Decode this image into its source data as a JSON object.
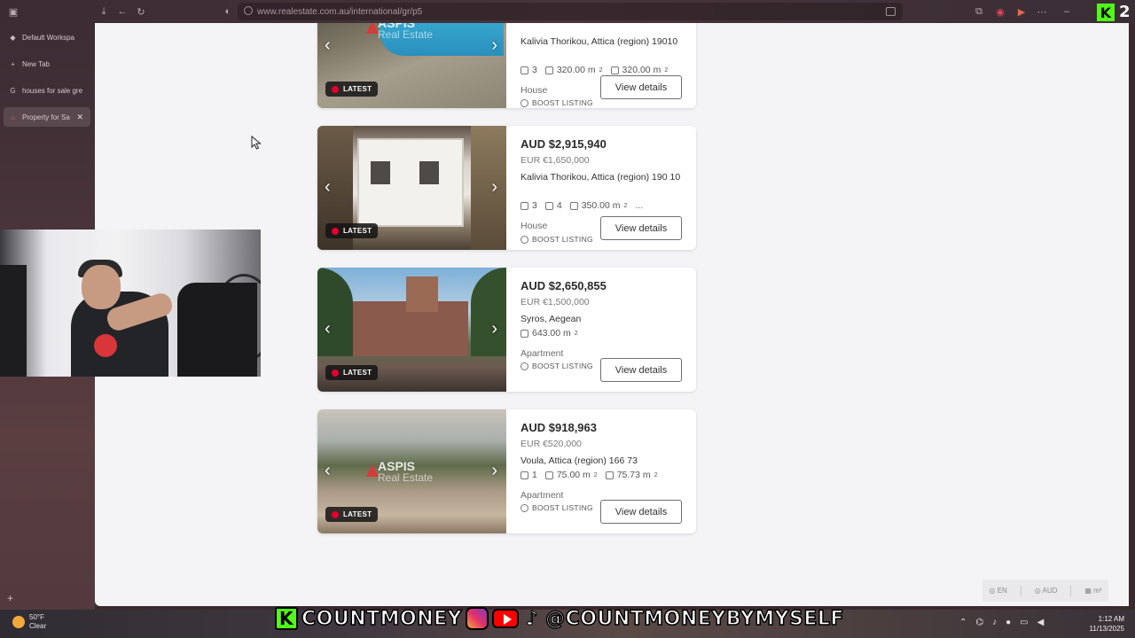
{
  "browser": {
    "url": "www.realestate.com.au/international/gr/p5",
    "workspace": "Default Workspa",
    "new_tab": "New Tab",
    "tabs": [
      {
        "label": "houses for sale gre",
        "active": false
      },
      {
        "label": "Property for Sa",
        "active": true
      }
    ]
  },
  "listings": [
    {
      "price": "",
      "eur": "",
      "address": "Kalivia Thorikou, Attica (region) 19010",
      "features": [
        {
          "icon": "bed-icon",
          "value": "3"
        },
        {
          "icon": "land-area-icon",
          "value": "320.00 m",
          "sup": "2"
        },
        {
          "icon": "floor-area-icon",
          "value": "320.00 m",
          "sup": "2"
        }
      ],
      "type": "House",
      "boost": "BOOST LISTING",
      "button": "View details",
      "badge": "LATEST",
      "watermark": "ASPIS",
      "watermark_sub": "Real Estate"
    },
    {
      "price": "AUD $2,915,940",
      "eur": "EUR €1,650,000",
      "address": "Kalivia Thorikou, Attica (region) 190 10",
      "features": [
        {
          "icon": "bed-icon",
          "value": "3"
        },
        {
          "icon": "bath-icon",
          "value": "4"
        },
        {
          "icon": "land-area-icon",
          "value": "350.00 m",
          "sup": "2"
        },
        {
          "icon": "more-icon",
          "value": "..."
        }
      ],
      "type": "House",
      "boost": "BOOST LISTING",
      "button": "View details",
      "badge": "LATEST"
    },
    {
      "price": "AUD $2,650,855",
      "eur": "EUR €1,500,000",
      "address": "Syros, Aegean",
      "features": [
        {
          "icon": "land-area-icon",
          "value": "643.00 m",
          "sup": "2"
        }
      ],
      "type": "Apartment",
      "boost": "BOOST LISTING",
      "button": "View details",
      "badge": "LATEST"
    },
    {
      "price": "AUD $918,963",
      "eur": "EUR €520,000",
      "address": "Voula, Attica (region) 166 73",
      "features": [
        {
          "icon": "bath-icon",
          "value": "1"
        },
        {
          "icon": "land-area-icon",
          "value": "75.00 m",
          "sup": "2"
        },
        {
          "icon": "floor-area-icon",
          "value": "75.73 m",
          "sup": "2"
        }
      ],
      "type": "Apartment",
      "boost": "BOOST LISTING",
      "button": "View details",
      "badge": "LATEST",
      "watermark": "ASPIS",
      "watermark_sub": "Real Estate"
    }
  ],
  "settings_bar": {
    "lang": "EN",
    "currency": "AUD",
    "unit": "m²"
  },
  "overlay": {
    "k_letter": "K",
    "left_text": "COUNTMONEY",
    "right_text": "@COUNTMONEYBYMYSELF",
    "k_top": "K",
    "k_num": "2"
  },
  "taskbar": {
    "temp": "50°F",
    "condition": "Clear",
    "time": "1:12 AM",
    "date": "11/13/2025"
  },
  "colors": {
    "latest_dot": "#e4002b",
    "kick_green": "#53fc18",
    "page_bg": "#f4f4f6"
  }
}
